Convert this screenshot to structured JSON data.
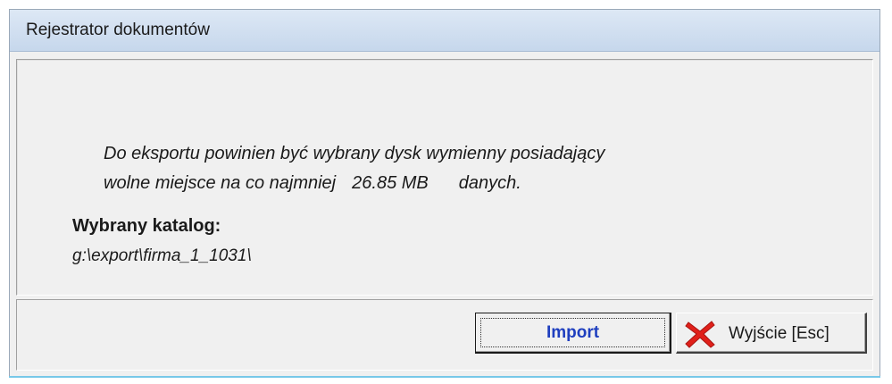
{
  "window": {
    "title": "Rejestrator dokumentów"
  },
  "message": {
    "line1": "Do eksportu powinien być wybrany dysk wymienny posiadający",
    "line2_prefix": "wolne miejsce na co najmniej",
    "size": "26.85 MB",
    "line2_suffix": "danych."
  },
  "directory": {
    "label": "Wybrany katalog:",
    "path": "g:\\export\\firma_1_1031\\"
  },
  "buttons": {
    "import_label": "Import",
    "exit_label": "Wyjście  [Esc]",
    "exit_icon": "close-x-icon"
  },
  "colors": {
    "import_text": "#1f3fbf",
    "exit_icon": "#e0201a"
  }
}
